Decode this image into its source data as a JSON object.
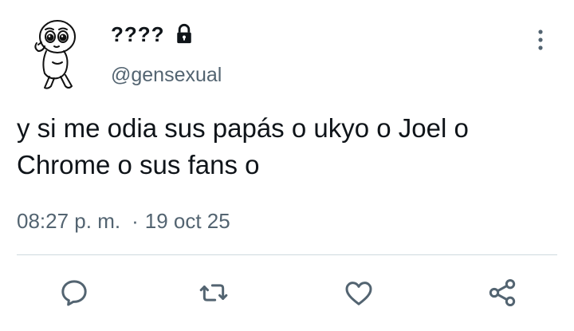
{
  "author": {
    "display_name": "????",
    "handle": "@gensexual",
    "protected_icon": "lock-icon",
    "avatar_icon": "cartoon-character-avatar"
  },
  "tweet": {
    "text": "y si me odia sus papás o ukyo o Joel o\nChrome o sus fans o",
    "time": "08:27 p. m.",
    "separator": "·",
    "date": "19 oct 25"
  },
  "actions": [
    {
      "name": "reply",
      "icon": "reply-bubble-icon"
    },
    {
      "name": "retweet",
      "icon": "retweet-icon"
    },
    {
      "name": "like",
      "icon": "heart-icon"
    },
    {
      "name": "share",
      "icon": "share-icon"
    }
  ],
  "menu": {
    "icon": "vertical-dots-icon"
  },
  "colors": {
    "text": "#0f1419",
    "secondary": "#536471",
    "divider": "#cfd9de",
    "background": "#ffffff"
  }
}
